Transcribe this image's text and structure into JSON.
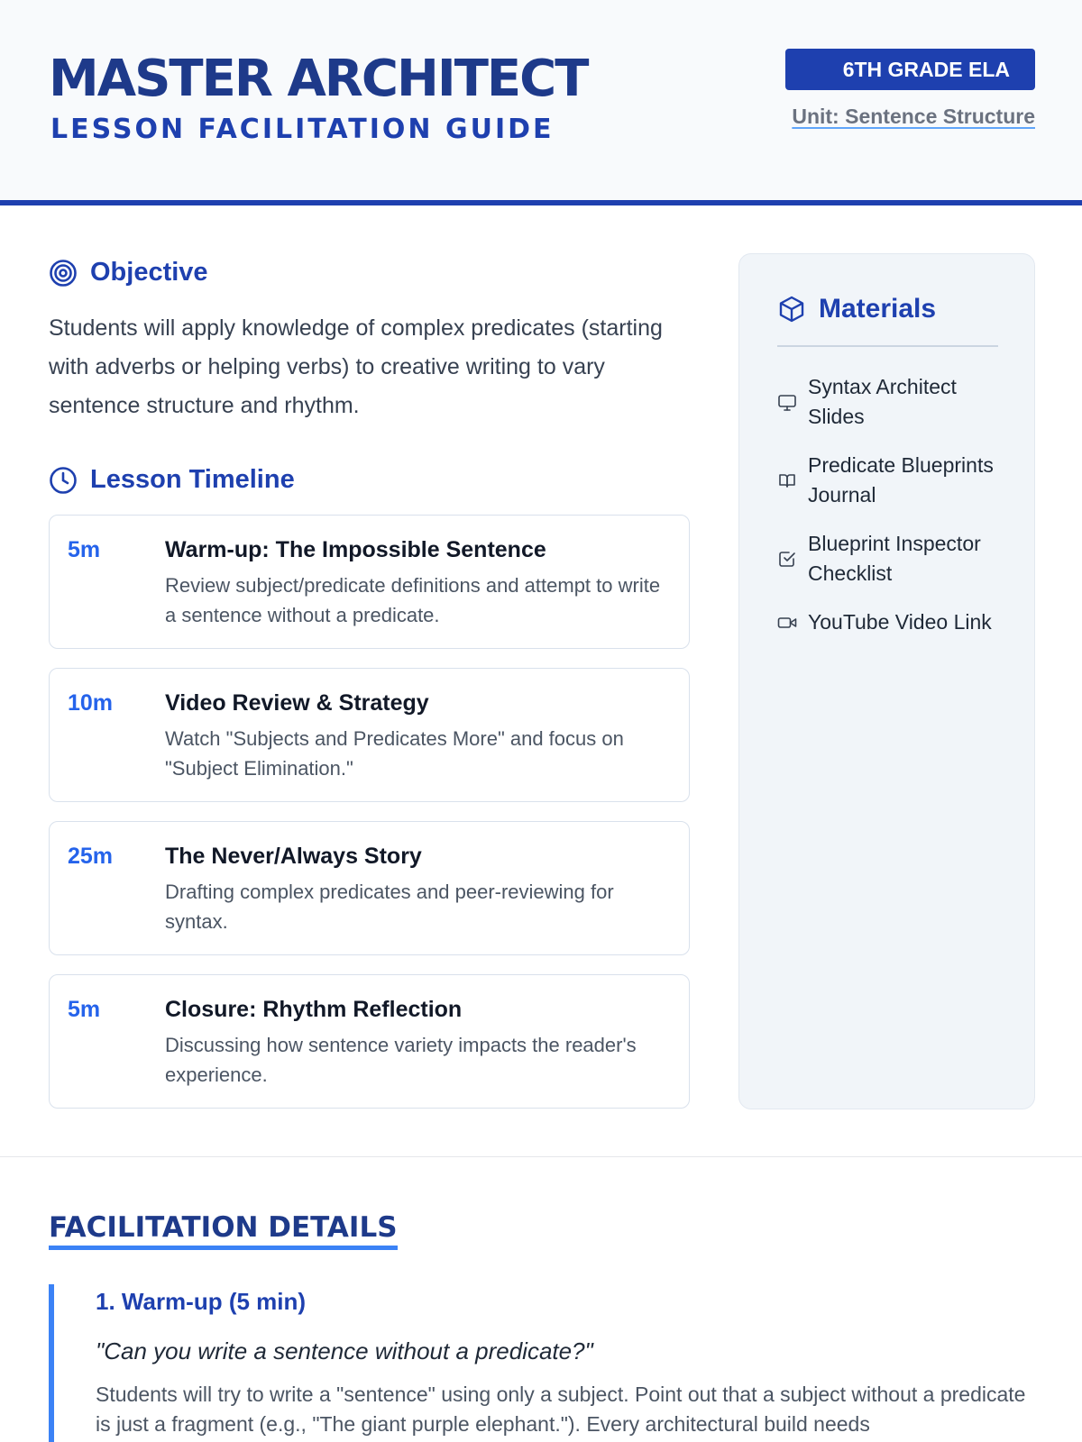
{
  "header": {
    "title": "MASTER ARCHITECT",
    "subtitle": "LESSON FACILITATION GUIDE",
    "grade_badge": "6TH GRADE ELA",
    "unit": "Unit: Sentence Structure"
  },
  "objective": {
    "heading": "Objective",
    "icon": "target-icon",
    "text": "Students will apply knowledge of complex predicates (starting with adverbs or helping verbs) to creative writing to vary sentence structure and rhythm."
  },
  "timeline": {
    "heading": "Lesson Timeline",
    "icon": "clock-icon",
    "items": [
      {
        "time": "5m",
        "title": "Warm-up: The Impossible Sentence",
        "description": "Review subject/predicate definitions and attempt to write a sentence without a predicate."
      },
      {
        "time": "10m",
        "title": "Video Review & Strategy",
        "description": "Watch \"Subjects and Predicates More\" and focus on \"Subject Elimination.\""
      },
      {
        "time": "25m",
        "title": "The Never/Always Story",
        "description": "Drafting complex predicates and peer-reviewing for syntax."
      },
      {
        "time": "5m",
        "title": "Closure: Rhythm Reflection",
        "description": "Discussing how sentence variety impacts the reader's experience."
      }
    ]
  },
  "materials": {
    "heading": "Materials",
    "icon": "cube-icon",
    "items": [
      {
        "label": "Syntax Architect Slides",
        "icon": "monitor-icon"
      },
      {
        "label": "Predicate Blueprints Journal",
        "icon": "book-icon"
      },
      {
        "label": "Blueprint Inspector Checklist",
        "icon": "checkbox-icon"
      },
      {
        "label": "YouTube Video Link",
        "icon": "video-icon"
      }
    ]
  },
  "facilitation": {
    "heading": "FACILITATION DETAILS",
    "steps": [
      {
        "title": "1. Warm-up (5 min)",
        "quote": "\"Can you write a sentence without a predicate?\"",
        "body": "Students will try to write a \"sentence\" using only a subject. Point out that a subject without a predicate is just a fragment (e.g., \"The giant purple elephant.\"). Every architectural build needs"
      }
    ]
  },
  "colors": {
    "primary": "#1e40af",
    "dark_primary": "#1e3a8a",
    "accent": "#3b82f6",
    "time_blue": "#2563eb",
    "header_bg": "#f8fafc",
    "panel_bg": "#f1f5f9"
  }
}
